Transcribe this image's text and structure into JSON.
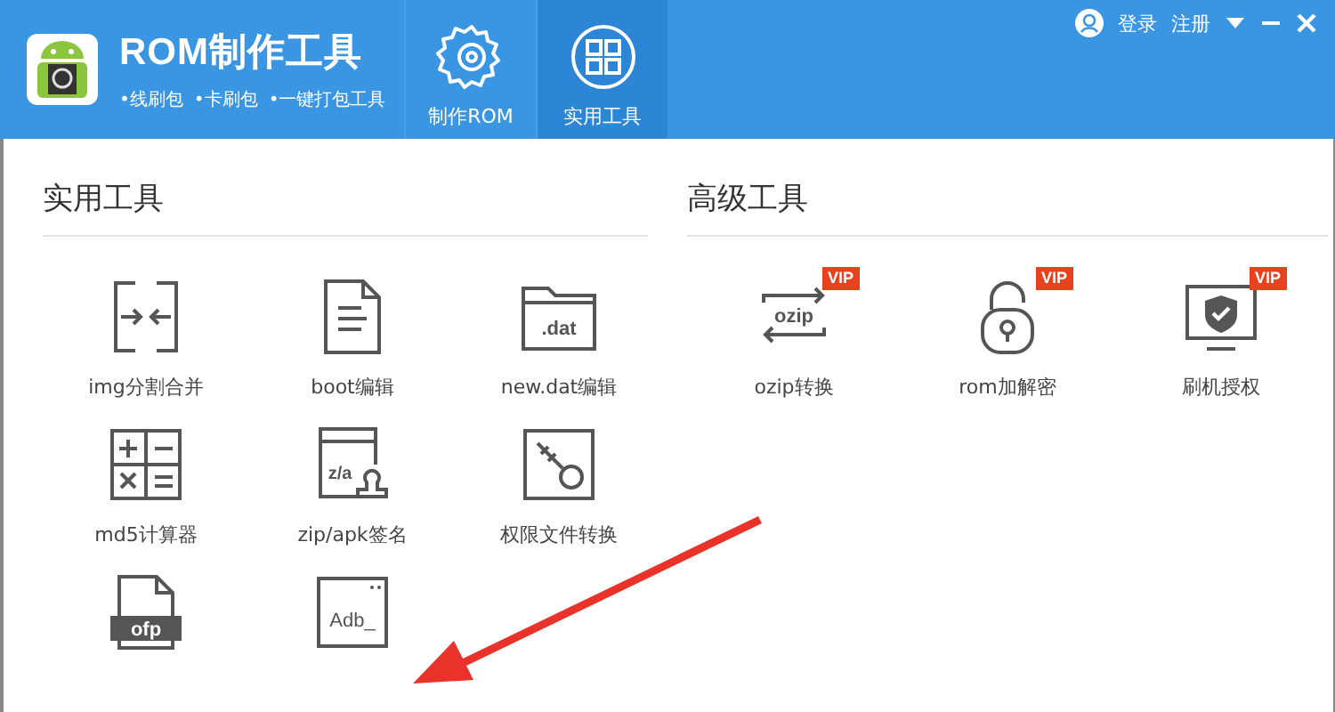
{
  "app": {
    "title": "ROM制作工具",
    "features": [
      "•线刷包",
      "•卡刷包",
      "•一键打包工具"
    ]
  },
  "nav": [
    {
      "label": "制作ROM",
      "selected": false
    },
    {
      "label": "实用工具",
      "selected": true
    }
  ],
  "account": {
    "login": "登录",
    "register": "注册"
  },
  "tools": {
    "heading": "实用工具",
    "items": [
      {
        "label": "img分割合并"
      },
      {
        "label": "boot编辑"
      },
      {
        "label": "new.dat编辑",
        "icon_text": ".dat"
      },
      {
        "label": "md5计算器"
      },
      {
        "label": "zip/apk签名",
        "icon_text": "z/a"
      },
      {
        "label": "权限文件转换"
      },
      {
        "icon_text": "ofp"
      },
      {
        "icon_text": "Adb_"
      }
    ]
  },
  "advanced": {
    "heading": "高级工具",
    "items": [
      {
        "label": "ozip转换",
        "badge": "VIP",
        "icon_text": "ozip"
      },
      {
        "label": "rom加解密",
        "badge": "VIP"
      },
      {
        "label": "刷机授权",
        "badge": "VIP"
      }
    ]
  }
}
